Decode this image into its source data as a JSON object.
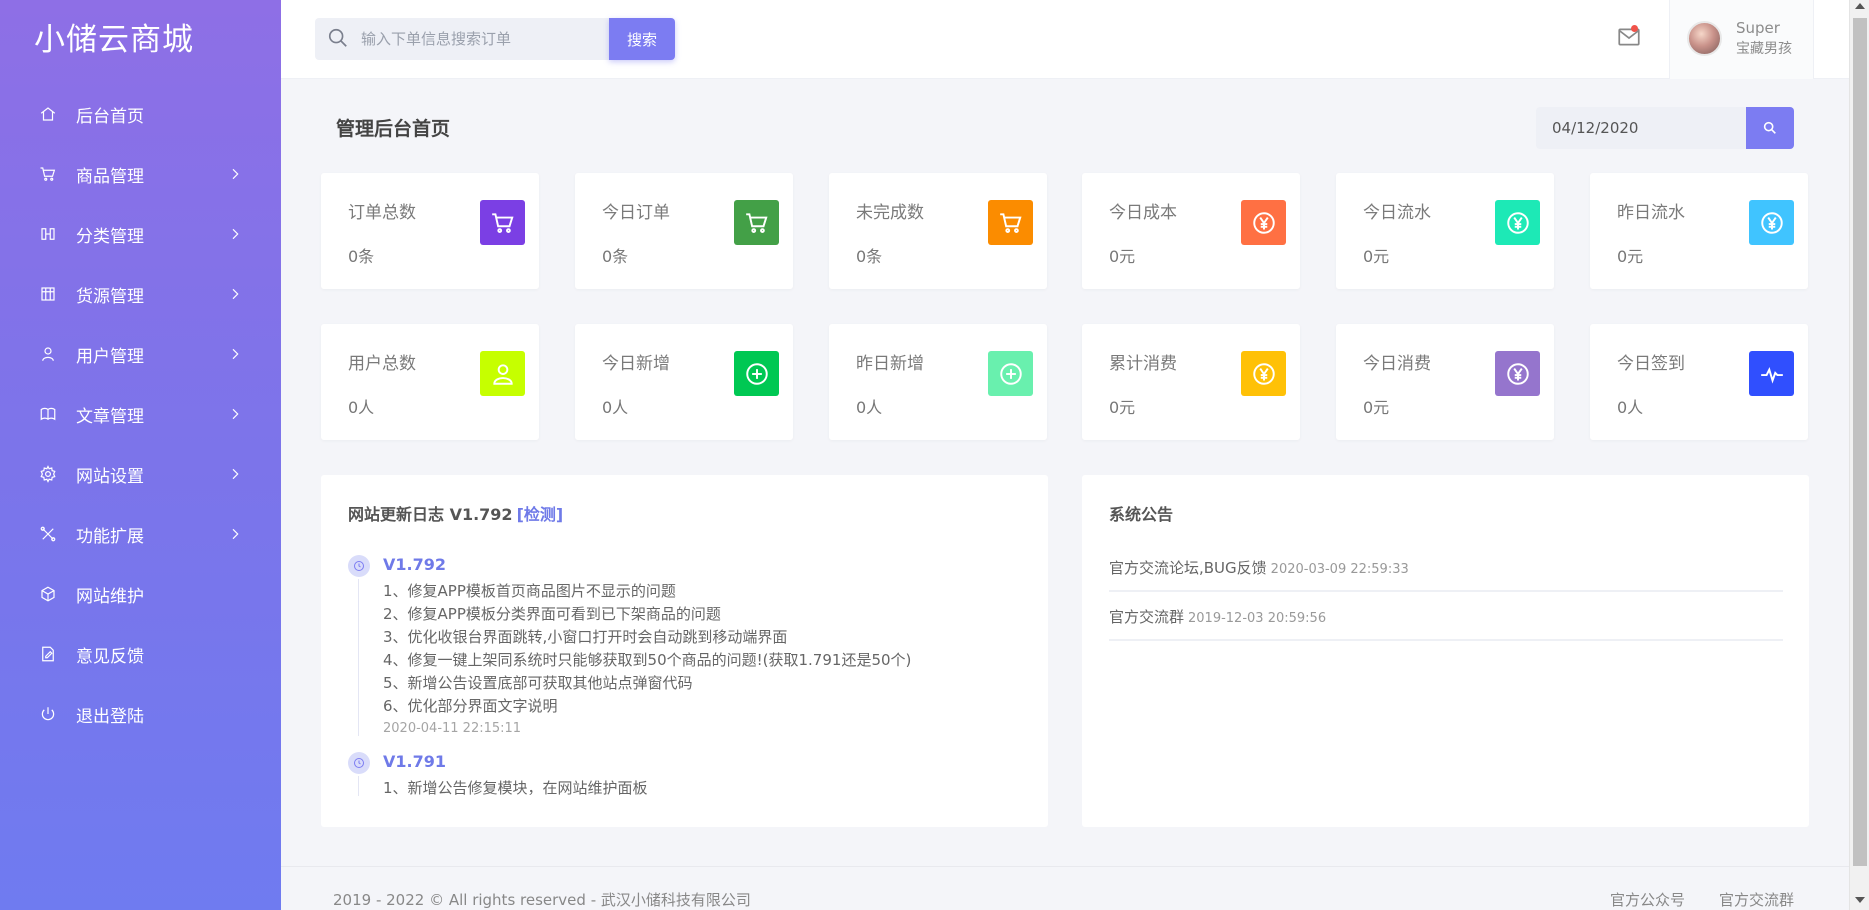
{
  "brand": "小储云商城",
  "sidebar": {
    "items": [
      {
        "label": "后台首页",
        "icon": "home-icon",
        "has_arrow": false
      },
      {
        "label": "商品管理",
        "icon": "cart-icon",
        "has_arrow": true
      },
      {
        "label": "分类管理",
        "icon": "columns-icon",
        "has_arrow": true
      },
      {
        "label": "货源管理",
        "icon": "building-icon",
        "has_arrow": true
      },
      {
        "label": "用户管理",
        "icon": "user-icon",
        "has_arrow": true
      },
      {
        "label": "文章管理",
        "icon": "book-icon",
        "has_arrow": true
      },
      {
        "label": "网站设置",
        "icon": "gear-icon",
        "has_arrow": true
      },
      {
        "label": "功能扩展",
        "icon": "tools-icon",
        "has_arrow": true
      },
      {
        "label": "网站维护",
        "icon": "cube-icon",
        "has_arrow": false
      },
      {
        "label": "意见反馈",
        "icon": "edit-icon",
        "has_arrow": false
      },
      {
        "label": "退出登陆",
        "icon": "power-icon",
        "has_arrow": false
      }
    ]
  },
  "header": {
    "search_placeholder": "输入下单信息搜索订单",
    "search_button": "搜索",
    "user_name": "Super",
    "user_role": "宝藏男孩"
  },
  "page": {
    "title": "管理后台首页",
    "date": "04/12/2020"
  },
  "stats_row1": [
    {
      "label": "订单总数",
      "value": "0条",
      "icon": "cart-icon",
      "color": "#7b3fe4"
    },
    {
      "label": "今日订单",
      "value": "0条",
      "icon": "cart-icon",
      "color": "#43a047"
    },
    {
      "label": "未完成数",
      "value": "0条",
      "icon": "cart-icon",
      "color": "#fb8c00"
    },
    {
      "label": "今日成本",
      "value": "0元",
      "icon": "yen-icon",
      "color": "#ff7043"
    },
    {
      "label": "今日流水",
      "value": "0元",
      "icon": "yen-icon",
      "color": "#1de9b6"
    },
    {
      "label": "昨日流水",
      "value": "0元",
      "icon": "yen-icon",
      "color": "#40c4ff"
    }
  ],
  "stats_row2": [
    {
      "label": "用户总数",
      "value": "0人",
      "icon": "users-icon",
      "color": "#c6ff00"
    },
    {
      "label": "今日新增",
      "value": "0人",
      "icon": "plus-circle-icon",
      "color": "#00c853"
    },
    {
      "label": "昨日新增",
      "value": "0人",
      "icon": "plus-circle-icon",
      "color": "#69f0ae"
    },
    {
      "label": "累计消费",
      "value": "0元",
      "icon": "yen-icon",
      "color": "#ffc107"
    },
    {
      "label": "今日消费",
      "value": "0元",
      "icon": "yen-icon",
      "color": "#9575cd"
    },
    {
      "label": "今日签到",
      "value": "0人",
      "icon": "pulse-icon",
      "color": "#304ffe"
    }
  ],
  "changelog": {
    "title": "网站更新日志 V1.792",
    "check_link": "[检测]",
    "versions": [
      {
        "version": "V1.792",
        "items": [
          "1、修复APP模板首页商品图片不显示的问题",
          "2、修复APP模板分类界面可看到已下架商品的问题",
          "3、优化收银台界面跳转,小窗口打开时会自动跳到移动端界面",
          "4、修复一键上架同系统时只能够获取到50个商品的问题!(获取1.791还是50个)",
          "5、新增公告设置底部可获取其他站点弹窗代码",
          "6、优化部分界面文字说明"
        ],
        "date": "2020-04-11 22:15:11"
      },
      {
        "version": "V1.791",
        "items": [
          "1、新增公告修复模块，在网站维护面板"
        ],
        "date": ""
      }
    ]
  },
  "announcements": {
    "title": "系统公告",
    "items": [
      {
        "text": "官方交流论坛,BUG反馈",
        "time": "2020-03-09 22:59:33"
      },
      {
        "text": "官方交流群",
        "time": "2019-12-03 20:59:56"
      }
    ]
  },
  "footer": {
    "copyright": "2019 - 2022 © All rights reserved - 武汉小储科技有限公司",
    "link1": "官方公众号",
    "link2": "官方交流群"
  }
}
